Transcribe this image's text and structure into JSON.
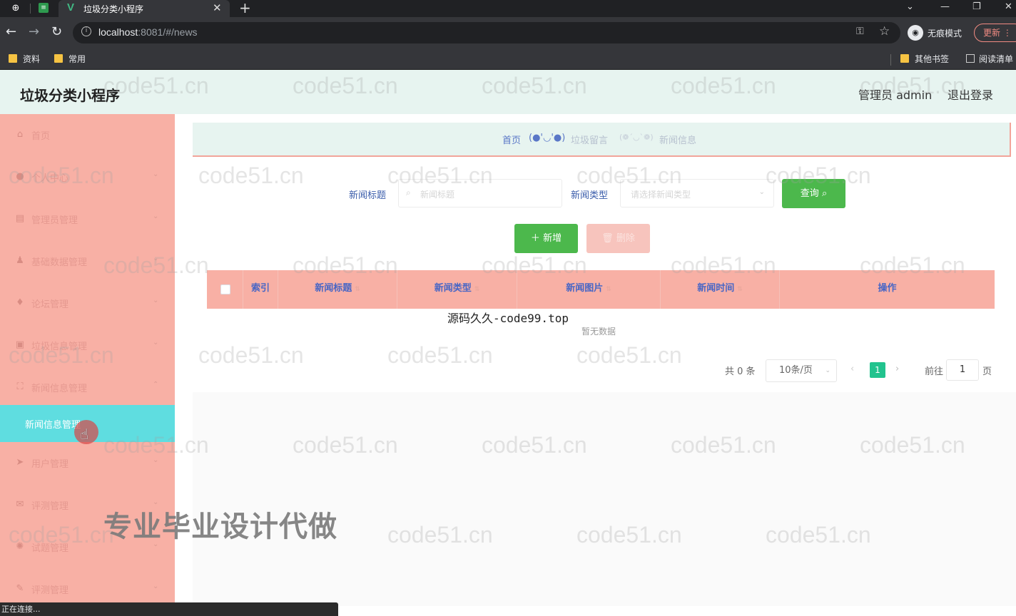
{
  "browser": {
    "tab_title": "垃圾分类小程序",
    "url_host": "localhost",
    "url_rest": ":8081/#/news",
    "incognito_label": "无痕模式",
    "update_label": "更新",
    "bookmarks": [
      "资料",
      "常用",
      "其他书签",
      "阅读清单"
    ],
    "status_text": "正在连接..."
  },
  "header": {
    "title": "垃圾分类小程序",
    "admin": "管理员 admin",
    "logout": "退出登录"
  },
  "sidebar": {
    "items": [
      {
        "label": "首页",
        "icon": "home-icon"
      },
      {
        "label": "个人中心",
        "icon": "user-icon"
      },
      {
        "label": "管理员管理",
        "icon": "admin-icon"
      },
      {
        "label": "基础数据管理",
        "icon": "data-icon"
      },
      {
        "label": "论坛管理",
        "icon": "forum-icon"
      },
      {
        "label": "垃圾信息管理",
        "icon": "trash-icon"
      },
      {
        "label": "新闻信息管理",
        "icon": "news-icon"
      },
      {
        "label": "用户管理",
        "icon": "users-icon"
      },
      {
        "label": "评测管理",
        "icon": "eval-icon"
      },
      {
        "label": "试题管理",
        "icon": "question-icon"
      },
      {
        "label": "评测管理",
        "icon": "eval-icon"
      }
    ],
    "submenu": "新闻信息管理"
  },
  "breadcrumb": {
    "home": "首页",
    "emote1": "(●'◡'●)",
    "second": "垃圾留言",
    "emote2": "(❁´◡`❁)",
    "third": "新闻信息"
  },
  "search": {
    "title_label": "新闻标题",
    "title_placeholder": "新闻标题",
    "type_label": "新闻类型",
    "type_placeholder": "请选择新闻类型",
    "query_button": "查询"
  },
  "actions": {
    "add": "新增",
    "delete": "删除"
  },
  "table": {
    "columns": [
      "索引",
      "新闻标题",
      "新闻类型",
      "新闻图片",
      "新闻时间",
      "操作"
    ],
    "empty_text": "暂无数据"
  },
  "pagination": {
    "total": "共 0 条",
    "page_size": "10条/页",
    "current_page": "1",
    "goto_label": "前往",
    "goto_value": "1",
    "page_suffix": "页"
  },
  "overlays": {
    "source_text": "源码久久-code99.top",
    "ad_text": "专业毕业设计代做",
    "watermark": "code51.cn"
  }
}
